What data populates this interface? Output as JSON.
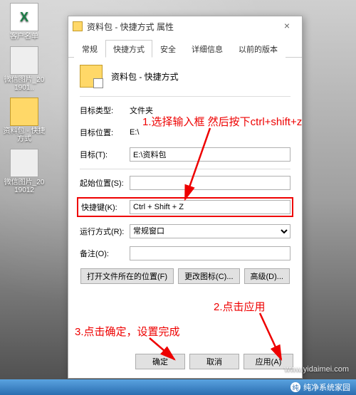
{
  "desktop": {
    "icons": [
      {
        "label": "客户名单"
      },
      {
        "label": "微信图片_201901.."
      },
      {
        "label": "资料包 - 快捷方式"
      },
      {
        "label": "微信图片_2019012"
      }
    ]
  },
  "dialog": {
    "title": "资料包 - 快捷方式 属性",
    "tabs": {
      "general": "常规",
      "shortcut": "快捷方式",
      "security": "安全",
      "details": "详细信息",
      "previous": "以前的版本"
    },
    "header_name": "资料包 - 快捷方式",
    "fields": {
      "target_type_label": "目标类型:",
      "target_type_value": "文件夹",
      "target_loc_label": "目标位置:",
      "target_loc_value": "E:\\",
      "target_label": "目标(T):",
      "target_value": "E:\\资料包",
      "start_in_label": "起始位置(S):",
      "start_in_value": "",
      "hotkey_label": "快捷键(K):",
      "hotkey_value": "Ctrl + Shift + Z",
      "run_label": "运行方式(R):",
      "run_value": "常规窗口",
      "comment_label": "备注(O):",
      "comment_value": ""
    },
    "mid_buttons": {
      "open_loc": "打开文件所在的位置(F)",
      "change_icon": "更改图标(C)...",
      "advanced": "高级(D)..."
    },
    "footer_buttons": {
      "ok": "确定",
      "cancel": "取消",
      "apply": "应用(A)"
    }
  },
  "annotations": {
    "a1": "1.选择输入框 然后按下ctrl+shift+z",
    "a2": "2.点击应用",
    "a3": "3.点击确定，设置完成"
  },
  "footer": {
    "brand": "纯净系统家园",
    "url": "www.yidaimei.com"
  }
}
